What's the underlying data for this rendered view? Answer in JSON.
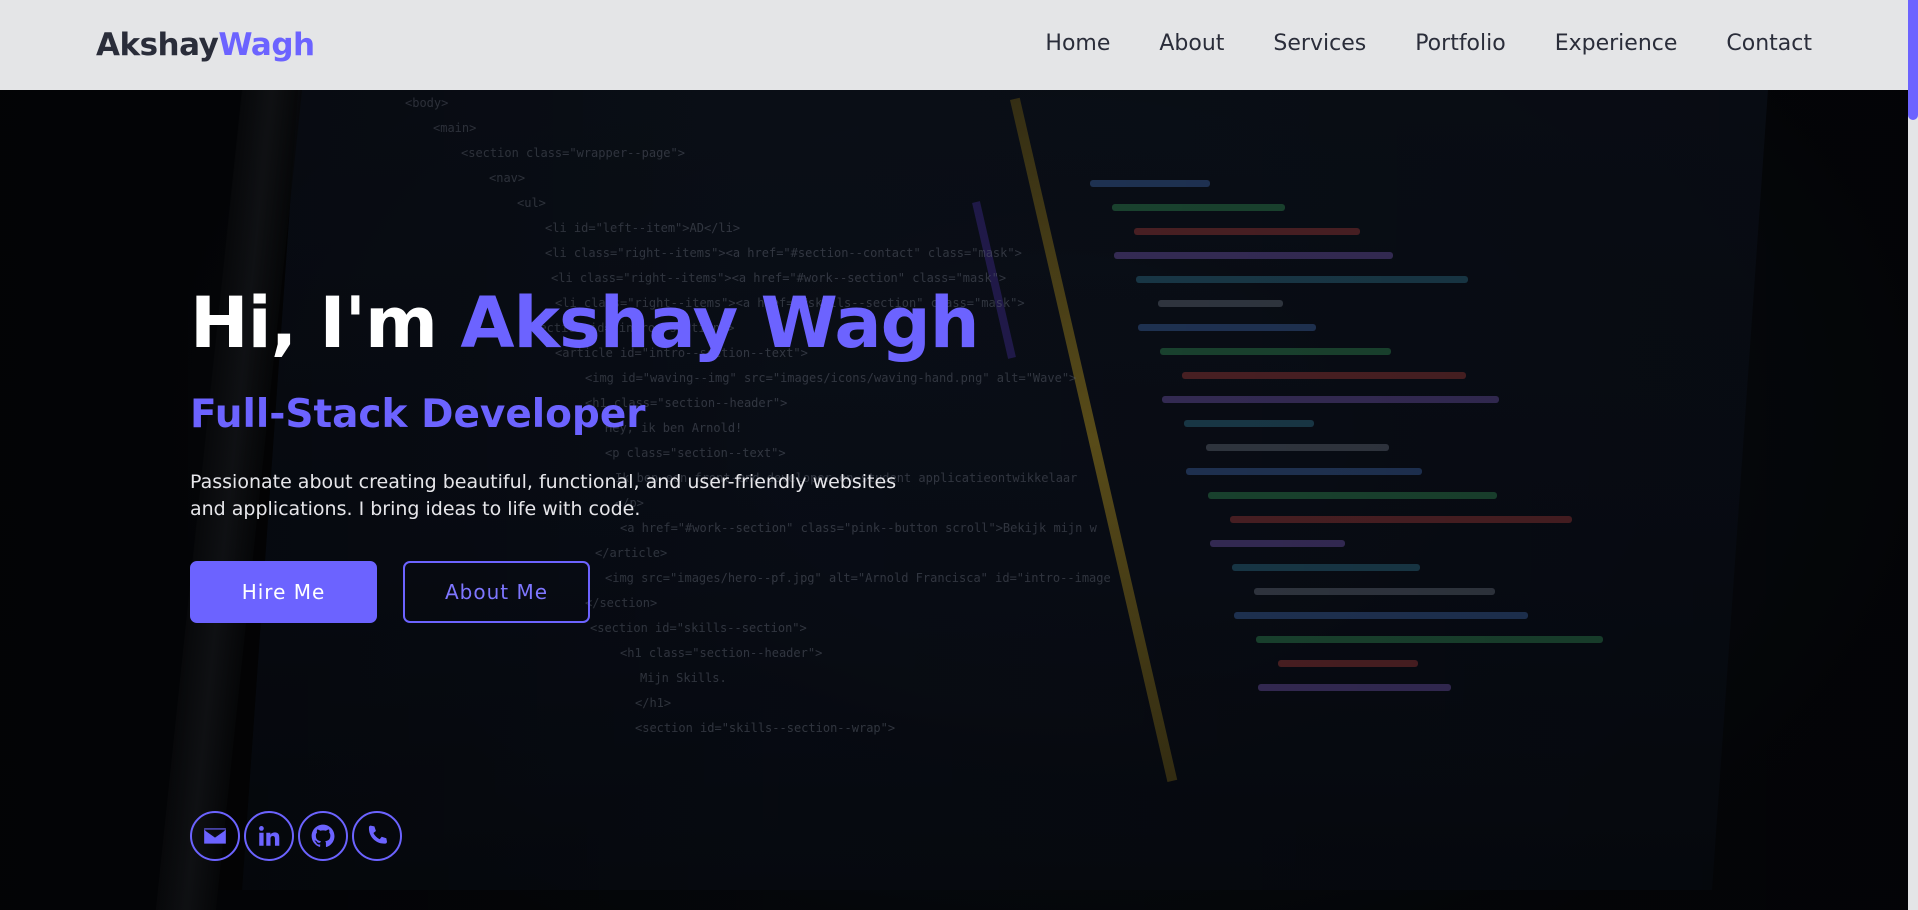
{
  "logo": {
    "first": "Akshay",
    "last": "Wagh"
  },
  "nav": {
    "items": [
      {
        "label": "Home",
        "active": true
      },
      {
        "label": "About",
        "active": false
      },
      {
        "label": "Services",
        "active": false
      },
      {
        "label": "Portfolio",
        "active": false
      },
      {
        "label": "Experience",
        "active": false
      },
      {
        "label": "Contact",
        "active": false
      }
    ]
  },
  "hero": {
    "greeting": "Hi, I'm ",
    "name": "Akshay Wagh",
    "subtitle": "Full-Stack Developer",
    "description": "Passionate about creating beautiful, functional, and user-friendly websites and applications. I bring ideas to life with code.",
    "primary_button": "Hire Me",
    "secondary_button": "About Me"
  },
  "socials": [
    {
      "icon": "envelope-icon"
    },
    {
      "icon": "linkedin-icon"
    },
    {
      "icon": "github-icon"
    },
    {
      "icon": "phone-icon"
    }
  ],
  "background_code": [
    "<body>",
    "<main>",
    "<section class=\"wrapper--page\">",
    "<nav>",
    "<ul>",
    "<li id=\"left--item\">AD</li>",
    "<li class=\"right--items\"><a href=\"#section--contact\" class=\"mask\">",
    "<li class=\"right--items\"><a href=\"#work--section\" class=\"mask\">",
    "<li class=\"right--items\"><a href=\"#skills--section\" class=\"mask\">",
    "<section id=\"intro--section\">",
    "<article id=\"intro--section--text\">",
    "<img id=\"waving--img\" src=\"images/icons/waving-hand.png\" alt=\"Wave\">",
    "<h1 class=\"section--header\">",
    "Hey, ik ben Arnold!",
    "<p class=\"section--text\">",
    "Ik ben een front-end developer en student applicatieontwikkelaar",
    "</p>",
    "<a href=\"#work--section\" class=\"pink--button scroll\">Bekijk mijn w",
    "</article>",
    "<img src=\"images/hero--pf.jpg\" alt=\"Arnold Francisca\" id=\"intro--image",
    "</section>",
    "<section id=\"skills--section\">",
    "<h1 class=\"section--header\">",
    "Mijn Skills.",
    "</h1>",
    "<section id=\"skills--section--wrap\">"
  ],
  "colors": {
    "accent": "#6c63ff",
    "navbar_bg": "#e4e5e7",
    "text_dark": "#2a2d3a",
    "hero_text": "#ffffff"
  }
}
